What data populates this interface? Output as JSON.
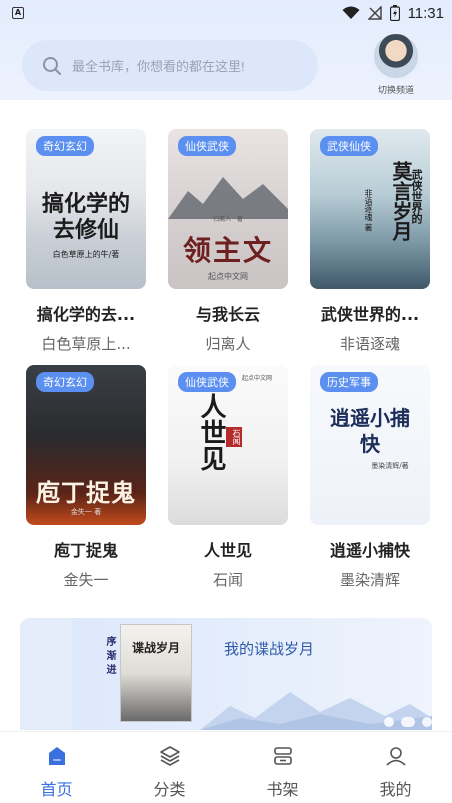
{
  "status_bar": {
    "app_badge": "A",
    "time": "11:31",
    "icons": [
      "wifi-icon",
      "no-signal-icon",
      "battery-icon"
    ]
  },
  "search": {
    "placeholder": "最全书库，你想看的都在这里!",
    "icon": "search-icon"
  },
  "channel": {
    "label": "切换频道"
  },
  "books": [
    {
      "tag": "奇幻玄幻",
      "cover_text": "搞化学的去修仙",
      "cover_sub": "白色草原上的牛/著",
      "title": "搞化学的去...",
      "author": "白色草原上..."
    },
    {
      "tag": "仙侠武侠",
      "cover_text": "领主文",
      "cover_sub": "起点中文网",
      "cover_top": "归离人 · 著",
      "title": "与我长云",
      "author": "归离人"
    },
    {
      "tag": "武侠仙侠",
      "cover_text": "莫言岁月",
      "cover_sub": "非语逐魂 著",
      "cover_side": "武侠世界的",
      "title": "武侠世界的...",
      "author": "非语逐魂"
    },
    {
      "tag": "奇幻玄幻",
      "cover_text": "庖丁捉鬼",
      "cover_sub": "金失一 著",
      "title": "庖丁捉鬼",
      "author": "金失一"
    },
    {
      "tag": "仙侠武侠",
      "cover_text": "人世见",
      "cover_sub": "起点中文网",
      "cover_top": "石闻",
      "title": "人世见",
      "author": "石闻"
    },
    {
      "tag": "历史军事",
      "cover_text": "逍遥小捕快",
      "cover_sub": "墨染清辉/著",
      "title": "逍遥小捕快",
      "author": "墨染清辉"
    }
  ],
  "banner": {
    "poem": "读书务在 循序渐进",
    "cover_title": "谍战岁月",
    "title": "我的谍战岁月"
  },
  "nav": [
    {
      "label": "首页",
      "icon": "home-icon",
      "active": true
    },
    {
      "label": "分类",
      "icon": "layers-icon",
      "active": false
    },
    {
      "label": "书架",
      "icon": "bookshelf-icon",
      "active": false
    },
    {
      "label": "我的",
      "icon": "profile-icon",
      "active": false
    }
  ],
  "colors": {
    "accent": "#3a6fe0",
    "tag_bg": "#5b8ff0",
    "search_bg": "#dde7fb",
    "header_bg": "#e3ecfd"
  }
}
